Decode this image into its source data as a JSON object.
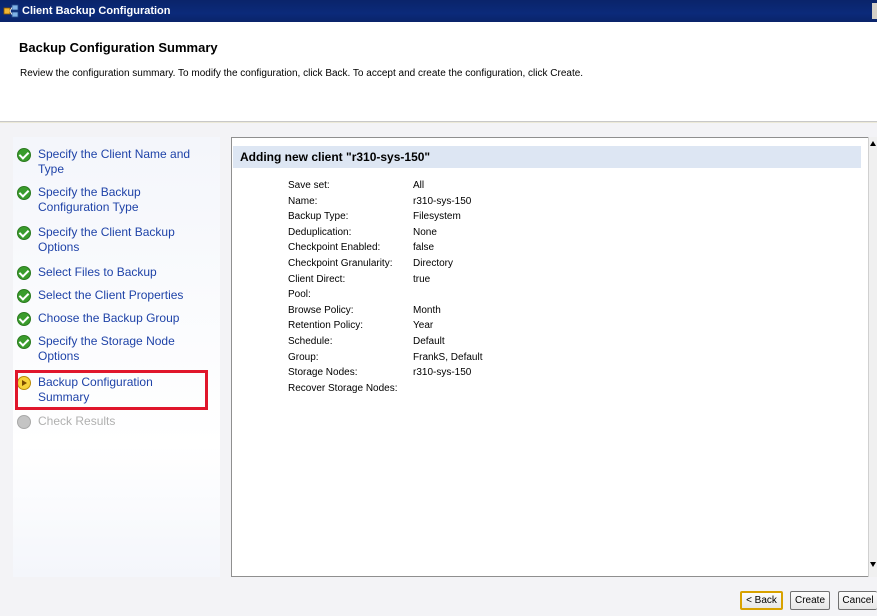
{
  "window": {
    "title": "Client Backup Configuration"
  },
  "header": {
    "heading": "Backup Configuration Summary",
    "description": "Review the configuration summary. To modify the configuration, click Back. To accept and create the configuration, click Create."
  },
  "steps": [
    {
      "label_lines": [
        "Specify the Client Name and",
        "Type"
      ],
      "status": "done"
    },
    {
      "label_lines": [
        "Specify the Backup",
        "Configuration Type"
      ],
      "status": "done"
    },
    {
      "label_lines": [
        "Specify the Client Backup",
        "Options"
      ],
      "status": "done"
    },
    {
      "label_lines": [
        "Select Files to Backup"
      ],
      "status": "done"
    },
    {
      "label_lines": [
        "Select the Client Properties"
      ],
      "status": "done"
    },
    {
      "label_lines": [
        "Choose the Backup Group"
      ],
      "status": "done"
    },
    {
      "label_lines": [
        "Specify the Storage Node",
        "Options"
      ],
      "status": "done"
    },
    {
      "label_lines": [
        "Backup Configuration",
        "Summary"
      ],
      "status": "current"
    },
    {
      "label_lines": [
        "Check Results"
      ],
      "status": "pending"
    }
  ],
  "summary": {
    "heading": "Adding new client \"r310-sys-150\"",
    "rows": [
      {
        "key": "Save set:",
        "value": "All"
      },
      {
        "key": "Name:",
        "value": "r310-sys-150"
      },
      {
        "key": "Backup Type:",
        "value": "Filesystem"
      },
      {
        "key": "Deduplication:",
        "value": "None"
      },
      {
        "key": "Checkpoint Enabled:",
        "value": "false"
      },
      {
        "key": "Checkpoint Granularity:",
        "value": "Directory"
      },
      {
        "key": "Client Direct:",
        "value": "true"
      },
      {
        "key": "Pool:",
        "value": ""
      },
      {
        "key": "Browse Policy:",
        "value": "Month"
      },
      {
        "key": "Retention Policy:",
        "value": "Year"
      },
      {
        "key": "Schedule:",
        "value": "Default"
      },
      {
        "key": "Group:",
        "value": "FrankS, Default"
      },
      {
        "key": "Storage Nodes:",
        "value": "r310-sys-150"
      },
      {
        "key": "Recover Storage Nodes:",
        "value": ""
      }
    ]
  },
  "buttons": {
    "back": "< Back",
    "create": "Create",
    "cancel": "Cancel"
  },
  "colors": {
    "titlebar": "#0a246a",
    "step_link": "#1f43a8",
    "step_done_icon": "#3a9c2c",
    "step_current_icon": "#f6d33b",
    "step_pending_icon": "#c4c4c4",
    "highlight_box": "#e0162b",
    "summary_header_bg": "#dde6f3"
  }
}
